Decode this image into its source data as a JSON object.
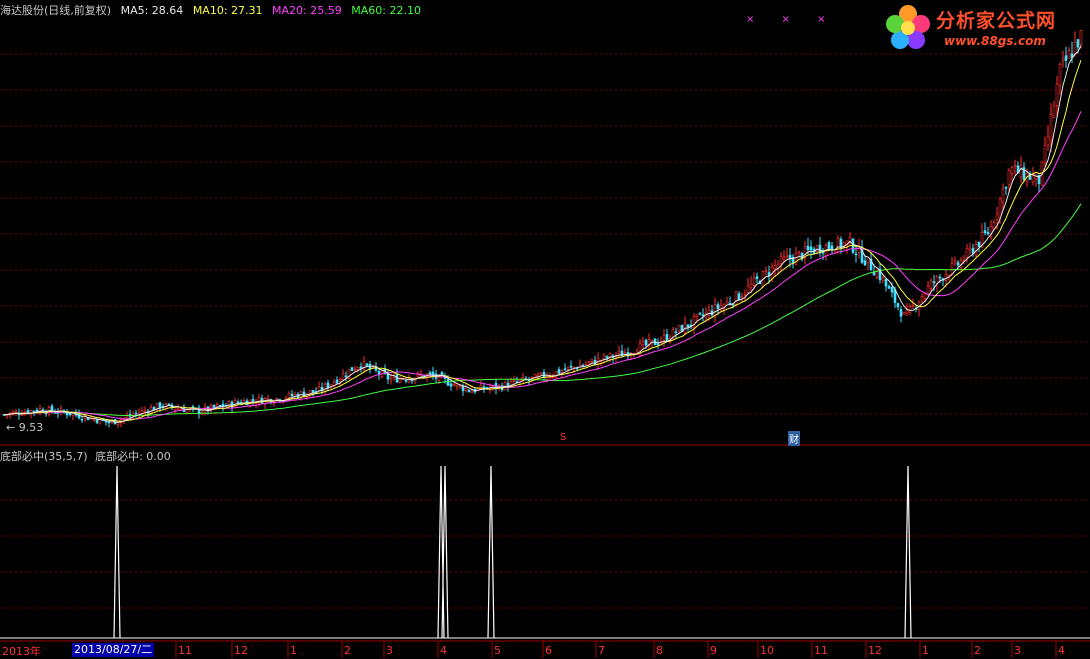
{
  "header": {
    "stock": "海达股份(日线,前复权)",
    "ma5_label": "MA5: 28.64",
    "ma10_label": "MA10: 27.31",
    "ma20_label": "MA20: 25.59",
    "ma60_label": "MA60: 22.10",
    "ma5_color": "#e8e8e8",
    "ma10_color": "#ffff40",
    "ma20_color": "#ff40ff",
    "ma60_color": "#40ff40"
  },
  "logo": {
    "title": "分析家公式网",
    "url": "www.88gs.com",
    "icon": "flower-logo-icon"
  },
  "markers": {
    "top_crosses": "× × ×",
    "s_marker": "S",
    "cai_marker": "财"
  },
  "low_label": "← 9.53",
  "indicator": {
    "name": "底部必中(35,5,7)",
    "value_label": "底部必中: 0.00"
  },
  "axis": {
    "year_label": "2013年",
    "selected_date": "2013/08/27/二",
    "months": [
      "11",
      "12",
      "1",
      "2",
      "3",
      "4",
      "5",
      "6",
      "7",
      "8",
      "9",
      "10",
      "11",
      "12",
      "1",
      "2",
      "3",
      "4"
    ]
  },
  "chart_data": {
    "type": "candlestick+line",
    "price_low": 9.53,
    "moving_averages": [
      {
        "name": "MA5",
        "last": 28.64
      },
      {
        "name": "MA10",
        "last": 27.31
      },
      {
        "name": "MA20",
        "last": 25.59
      },
      {
        "name": "MA60",
        "last": 22.1
      }
    ],
    "price_path": [
      [
        0,
        10.3
      ],
      [
        40,
        10.6
      ],
      [
        70,
        10.4
      ],
      [
        110,
        9.9
      ],
      [
        160,
        10.8
      ],
      [
        200,
        10.5
      ],
      [
        240,
        11.0
      ],
      [
        280,
        11.2
      ],
      [
        320,
        11.6
      ],
      [
        360,
        13.0
      ],
      [
        390,
        12.2
      ],
      [
        430,
        12.4
      ],
      [
        470,
        11.6
      ],
      [
        500,
        11.8
      ],
      [
        540,
        12.3
      ],
      [
        580,
        12.9
      ],
      [
        620,
        13.5
      ],
      [
        660,
        14.2
      ],
      [
        700,
        15.4
      ],
      [
        740,
        16.6
      ],
      [
        780,
        18.3
      ],
      [
        820,
        19.1
      ],
      [
        850,
        19.3
      ],
      [
        880,
        17.6
      ],
      [
        905,
        15.4
      ],
      [
        930,
        17.1
      ],
      [
        960,
        18.3
      ],
      [
        990,
        20.0
      ],
      [
        1010,
        23.2
      ],
      [
        1040,
        22.6
      ],
      [
        1060,
        28.3
      ],
      [
        1080,
        30.1
      ]
    ],
    "indicator_signals": [
      {
        "position": 117,
        "value": 1
      },
      {
        "position": 441,
        "value": 1
      },
      {
        "position": 445,
        "value": 1
      },
      {
        "position": 491,
        "value": 1
      },
      {
        "position": 908,
        "value": 1
      }
    ]
  }
}
